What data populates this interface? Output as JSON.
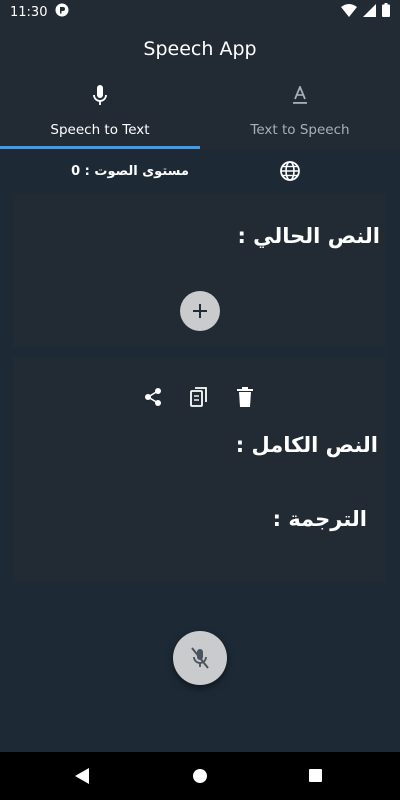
{
  "status_bar": {
    "time": "11:30",
    "icons": [
      "notification-icon",
      "wifi-icon",
      "cellular-icon",
      "battery-icon"
    ]
  },
  "app": {
    "title": "Speech App"
  },
  "tabs": [
    {
      "label": "Speech to Text",
      "icon": "mic-icon",
      "selected": true
    },
    {
      "label": "Text to Speech",
      "icon": "text-format-icon",
      "selected": false
    }
  ],
  "volume": {
    "text": "مستوى الصوت : 0"
  },
  "current_card": {
    "title": "النص الحالي :"
  },
  "full_card": {
    "title": "النص الكامل :",
    "translation_title": "الترجمة :",
    "actions": [
      "share-icon",
      "copy-icon",
      "delete-icon"
    ]
  },
  "colors": {
    "background": "#1d2a36",
    "surface": "#222b34",
    "accent": "#3d9be9",
    "button": "#c9cbcd"
  }
}
